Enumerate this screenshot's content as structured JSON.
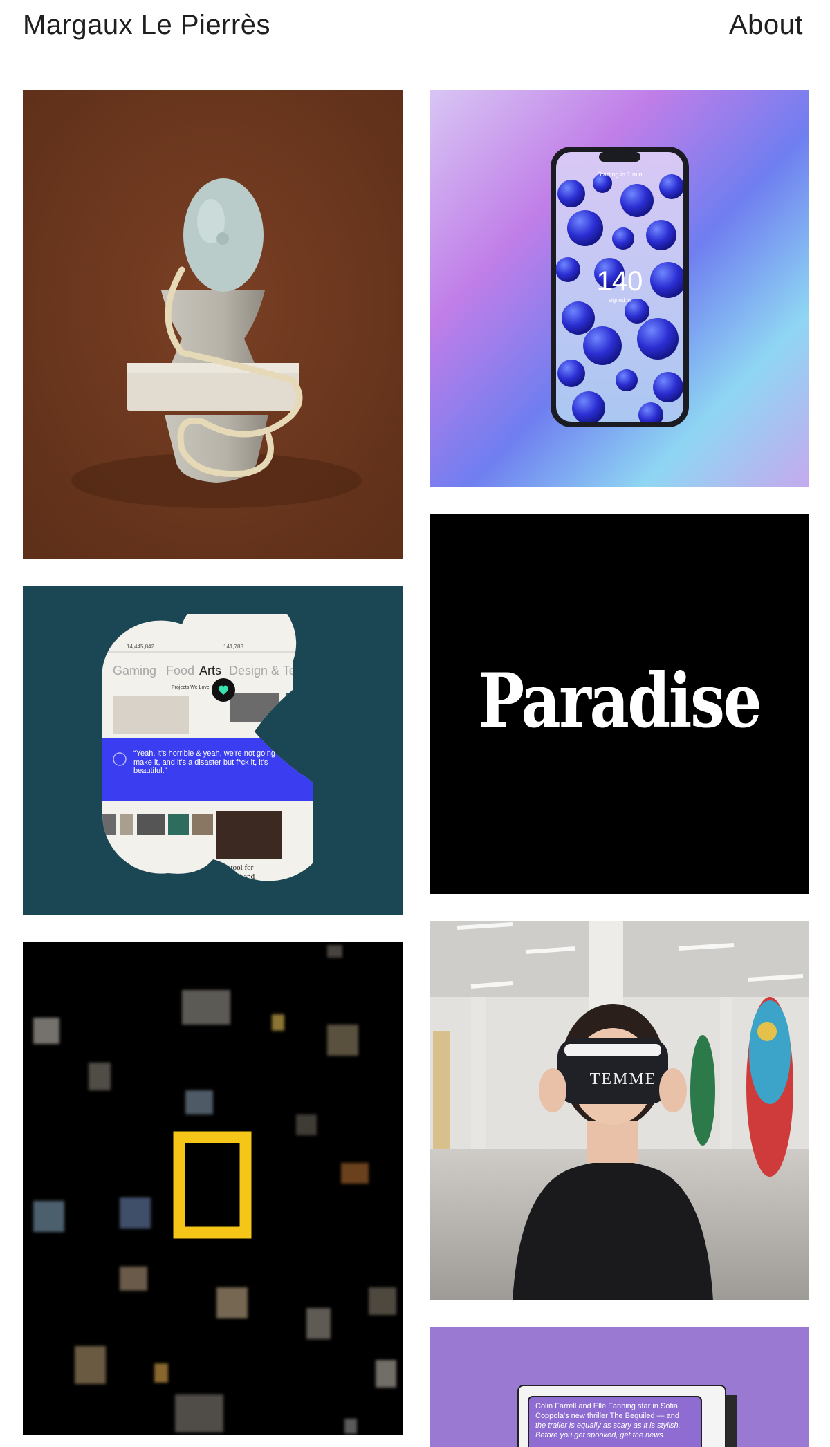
{
  "header": {
    "site_title": "Margaux Le Pierrès",
    "about_label": "About"
  },
  "projects": {
    "phone": {
      "status_text": "Starting in 1 min",
      "count": "140",
      "count_caption": "signed in"
    },
    "arts": {
      "stat_left": "14,445,842",
      "stat_right": "141,783",
      "categories": [
        "Gaming",
        "Food",
        "Arts",
        "Design & Tech"
      ],
      "section_label": "Projects We Love",
      "quote": "“Yeah, it's horrible & yeah, we're not going to make it, and it's a disaster but f*ck it, it's beautiful.”",
      "fund_text_1": "ew tool for",
      "fund_text_2": "to fund and"
    },
    "paradise": {
      "wordmark": "Paradise"
    },
    "vr": {
      "headset_brand": "TEMME"
    },
    "article": {
      "line_1": "Colin Farrell and Elle Fanning star in Sofia",
      "line_2": "Coppola's new thriller The Beguiled — and",
      "line_3": "the trailer is equally as scary as it is stylish.",
      "line_4": "Before you get spooked, get the news."
    }
  },
  "colors": {
    "accent_yellow": "#f5c518",
    "arts_blue": "#3b3df0",
    "arts_teal": "#1b4654",
    "article_purple": "#9979d2"
  }
}
